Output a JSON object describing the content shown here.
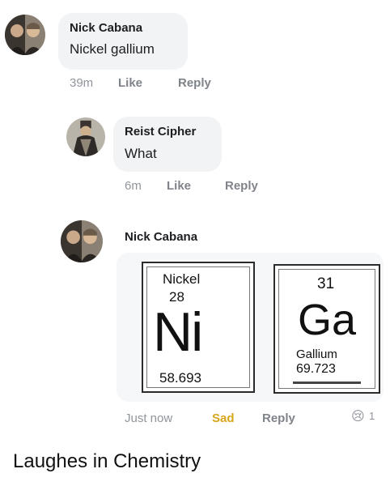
{
  "comments": [
    {
      "author": "Nick Cabana",
      "text": "Nickel gallium",
      "time": "39m",
      "like_label": "Like",
      "reply_label": "Reply"
    },
    {
      "author": "Reist Cipher",
      "text": "What",
      "time": "6m",
      "like_label": "Like",
      "reply_label": "Reply"
    },
    {
      "author": "Nick Cabana",
      "time": "Just now",
      "reaction_label": "Sad",
      "reply_label": "Reply",
      "reaction_count": "1",
      "reaction_emoji": "😢",
      "image": {
        "nickel": {
          "name": "Nickel",
          "number": "28",
          "symbol": "Ni",
          "mass": "58.693"
        },
        "gallium": {
          "number": "31",
          "symbol": "Ga",
          "name": "Gallium",
          "mass": "69.723"
        }
      }
    }
  ],
  "caption": "Laughes in Chemistry",
  "colors": {
    "bubble": "#f2f3f5",
    "meta_text": "#90949c",
    "sad_reaction": "#d9a51b"
  }
}
